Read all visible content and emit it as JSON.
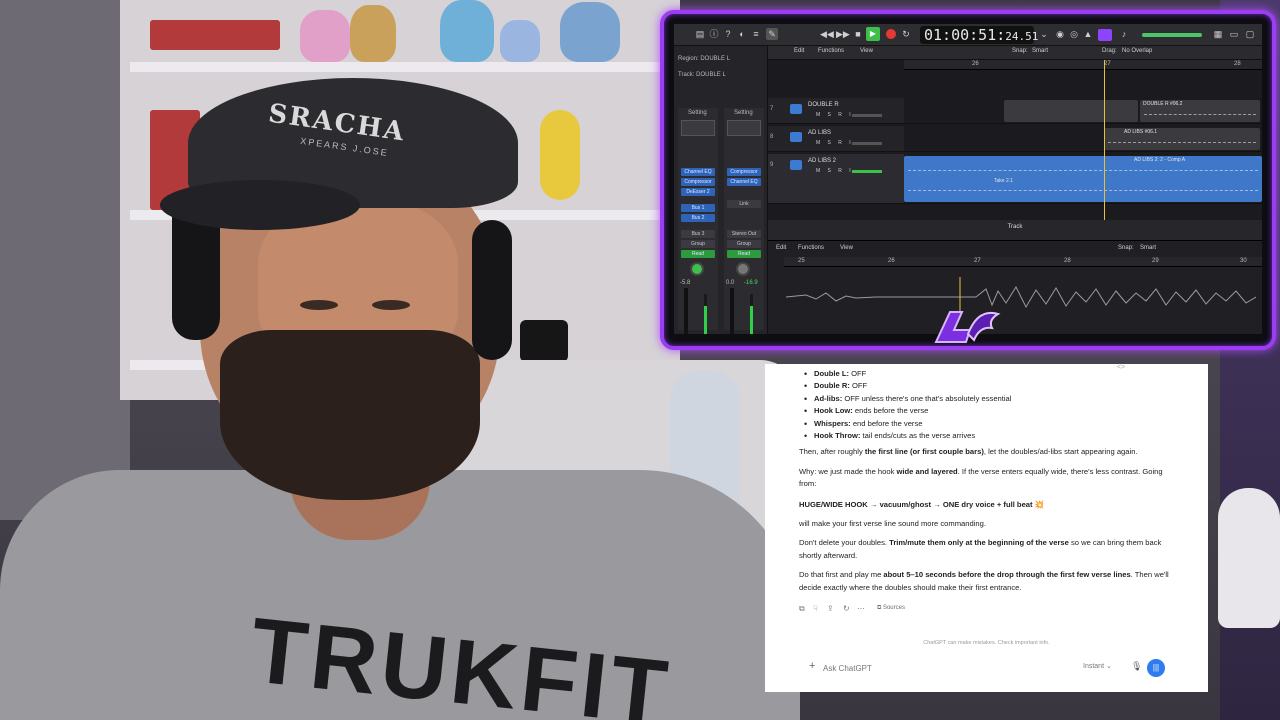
{
  "daw": {
    "timecode_main": "01:00:51:",
    "timecode_sub": "24.51",
    "inspector": {
      "region_label": "Region: DOUBLE L",
      "track_label": "Track: DOUBLE L",
      "strip1": {
        "setting": "Setting",
        "plugins": [
          "Channel EQ",
          "Compressor",
          "DeEsser 2"
        ],
        "send": "Bus 1",
        "send2": "Bus 2",
        "output": "Bus 3",
        "group": "Group",
        "mode": "Read",
        "pan": "-14",
        "vol": "-5.8"
      },
      "strip2": {
        "setting": "Setting",
        "plugins": [
          "Compressor",
          "Channel EQ"
        ],
        "send": "",
        "output": "Stereo Out",
        "group": "Group",
        "mode": "Read",
        "vol": "0.0",
        "peak": "-16.9",
        "link": "Link"
      }
    },
    "arrange_menu": {
      "edit": "Edit",
      "functions": "Functions",
      "view": "View",
      "snap_label": "Snap:",
      "snap_value": "Smart",
      "drag_label": "Drag:",
      "drag_value": "No Overlap"
    },
    "ruler": [
      "26",
      "27",
      "28"
    ],
    "tracks": [
      {
        "num": "7",
        "name": "DOUBLE R",
        "regions": [
          "DOUBLE R #06.2"
        ]
      },
      {
        "num": "8",
        "name": "AD LIBS",
        "regions": [
          "AD LIBS #06.1"
        ]
      },
      {
        "num": "9",
        "name": "AD LIBS 2",
        "regions": [
          "AD LIBS 2: 2 - Comp A",
          "Take 2.1"
        ]
      }
    ],
    "editor": {
      "title": "Track",
      "edit": "Edit",
      "functions": "Functions",
      "view": "View",
      "snap_label": "Snap:",
      "snap_value": "Smart",
      "ruler": [
        "25",
        "26",
        "27",
        "28",
        "29",
        "30"
      ]
    }
  },
  "chat": {
    "bullets": [
      {
        "label": "Double L:",
        "text": " OFF"
      },
      {
        "label": "Double R:",
        "text": " OFF"
      },
      {
        "label": "Ad-libs:",
        "text": " OFF unless there's one that's absolutely essential"
      },
      {
        "label": "Hook Low:",
        "text": " ends before the verse"
      },
      {
        "label": "Whispers:",
        "text": " end before the verse"
      },
      {
        "label": "Hook Throw:",
        "text": " tail ends/cuts as the verse arrives"
      }
    ],
    "p1_a": "Then, after roughly ",
    "p1_b": "the first line (or first couple bars)",
    "p1_c": ", let the doubles/ad-libs start appearing again.",
    "p2_a": "Why: we just made the hook ",
    "p2_b": "wide and layered",
    "p2_c": ". If the verse enters equally wide, there's less contrast. Going from:",
    "p3": "HUGE/WIDE HOOK → vacuum/ghost → ONE dry voice + full beat 💥",
    "p4": "will make your first verse line sound more commanding.",
    "p5_a": "Don't delete your doubles. ",
    "p5_b": "Trim/mute them only at the beginning of the verse",
    "p5_c": " so we can bring them back shortly afterward.",
    "p6_a": "Do that first and play me ",
    "p6_b": "about 5–10 seconds before the drop through the first few verse lines",
    "p6_c": ". Then we'll decide exactly where the doubles should make their first entrance.",
    "sources": "Sources",
    "disclaimer": "ChatGPT can make mistakes. Check important info.",
    "composer_placeholder": "Ask ChatGPT",
    "model": "Instant"
  },
  "cam": {
    "cap_text": "SRACHA",
    "cap_sub": "XPEARS J.OSE",
    "shirt_text": "TRUKFIT"
  }
}
